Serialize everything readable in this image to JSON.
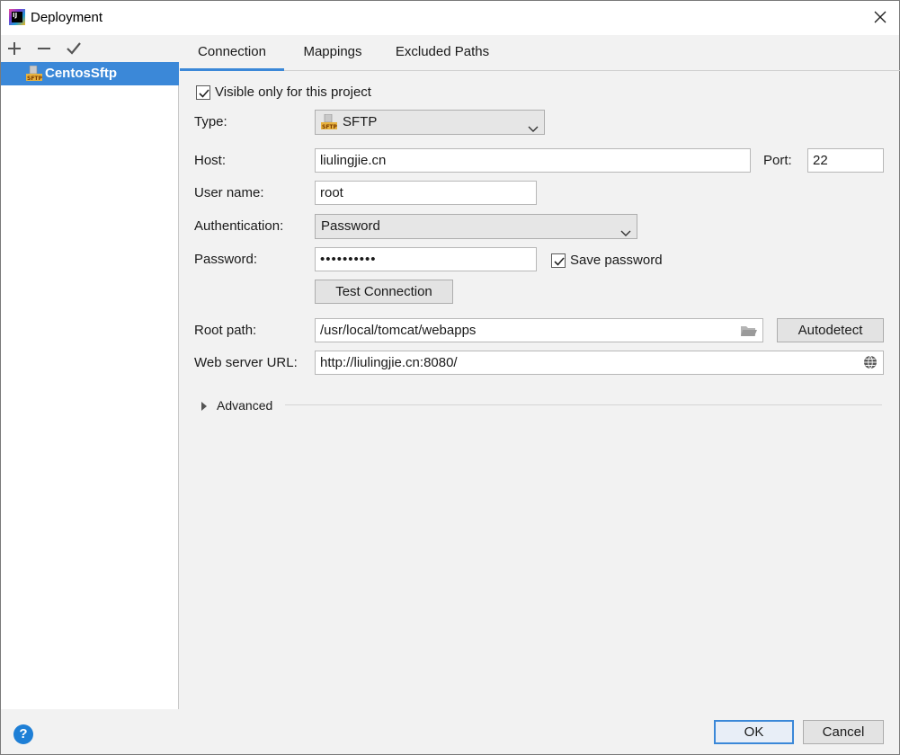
{
  "window": {
    "title": "Deployment"
  },
  "left_panel": {
    "items": [
      {
        "label": "CentosSftp",
        "icon": "sftp-server-icon"
      }
    ]
  },
  "tabs": [
    {
      "label": "Connection",
      "active": true
    },
    {
      "label": "Mappings",
      "active": false
    },
    {
      "label": "Excluded Paths",
      "active": false
    }
  ],
  "connection": {
    "visible_only_label": "Visible only for this project",
    "visible_only_checked": true,
    "type_label": "Type:",
    "type_value": "SFTP",
    "host_label": "Host:",
    "host_value": "liulingjie.cn",
    "port_label": "Port:",
    "port_value": "22",
    "username_label": "User name:",
    "username_value": "root",
    "auth_label": "Authentication:",
    "auth_value": "Password",
    "password_label": "Password:",
    "password_value": "••••••••••",
    "save_password_label": "Save password",
    "save_password_checked": true,
    "test_connection_label": "Test Connection",
    "root_path_label": "Root path:",
    "root_path_value": "/usr/local/tomcat/webapps",
    "autodetect_label": "Autodetect",
    "web_url_label": "Web server URL:",
    "web_url_value": "http://liulingjie.cn:8080/",
    "advanced_label": "Advanced"
  },
  "footer": {
    "ok_label": "OK",
    "cancel_label": "Cancel",
    "help_label": "?"
  },
  "colors": {
    "accent": "#3b88d8",
    "selection": "#3b88d8"
  }
}
